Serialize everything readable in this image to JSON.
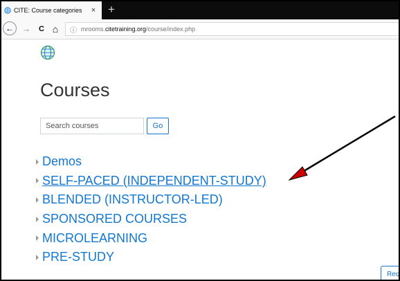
{
  "browser": {
    "tab": {
      "title": "CITE: Course categories",
      "close_glyph": "×",
      "favicon": "globe-icon"
    },
    "new_tab_glyph": "+",
    "nav": {
      "back_glyph": "←",
      "forward_glyph": "→",
      "reload_glyph": "C",
      "home_glyph": "⌂"
    },
    "url": {
      "prefix": "mrooms.",
      "domain": "citetraining.org",
      "path": "/course/index.php"
    }
  },
  "page": {
    "title": "Courses",
    "search": {
      "placeholder": "Search courses",
      "value": "",
      "button_label": "Go"
    },
    "categories": [
      {
        "label": "Demos"
      },
      {
        "label": "SELF-PACED (INDEPENDENT-STUDY)",
        "underlined": true
      },
      {
        "label": "BLENDED (INSTRUCTOR-LED)"
      },
      {
        "label": "SPONSORED COURSES"
      },
      {
        "label": "MICROLEARNING"
      },
      {
        "label": "PRE-STUDY"
      }
    ],
    "request_button_label": "Requ"
  },
  "colors": {
    "link": "#1177d1",
    "arrow": "#cc0000",
    "tabbar": "#0c0c0d"
  },
  "annotation": {
    "type": "arrow",
    "color": "#cc0000"
  }
}
